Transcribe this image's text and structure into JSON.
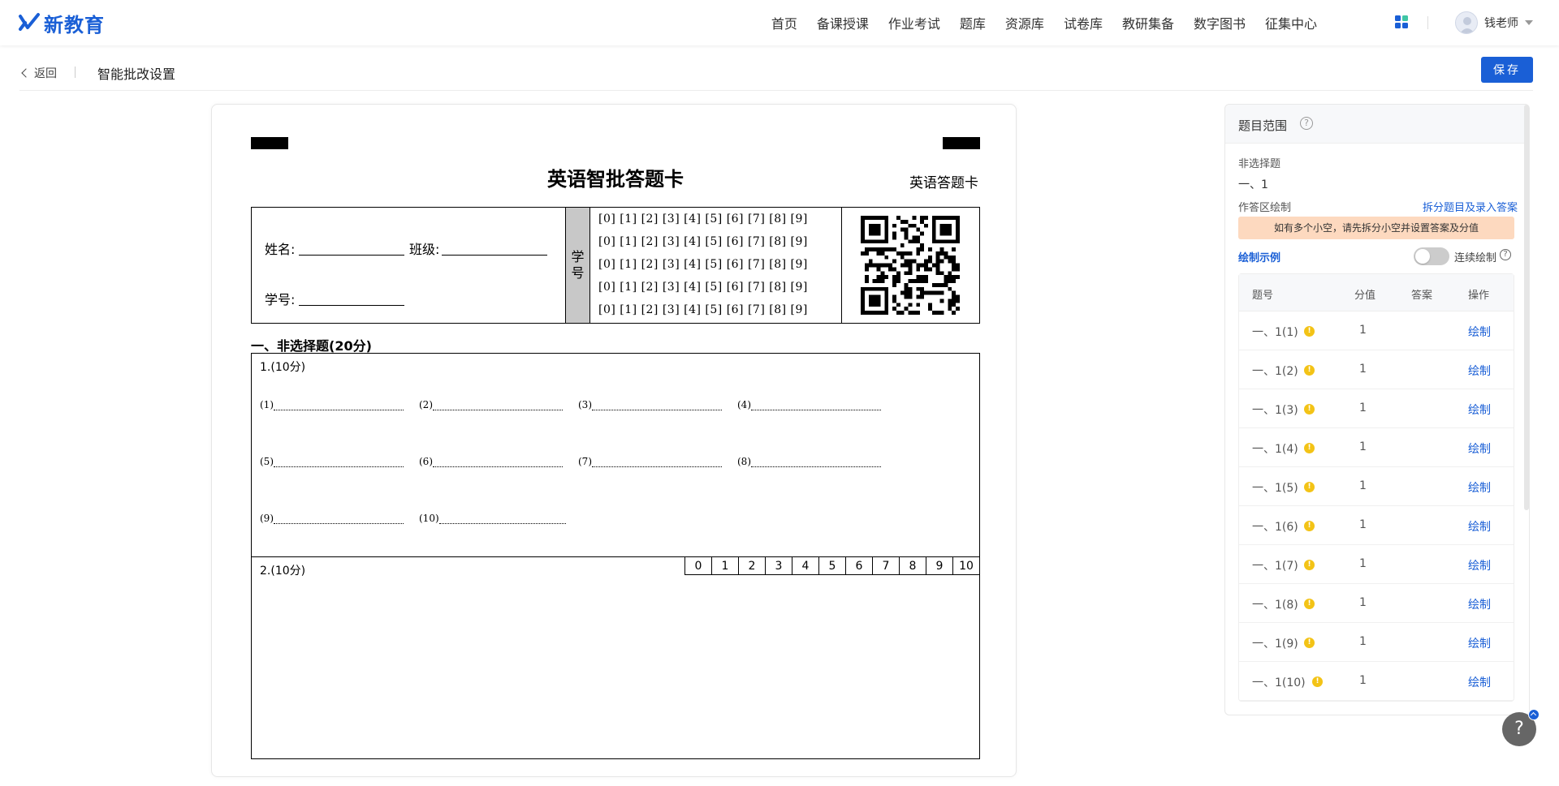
{
  "brand": {
    "name": "新教育",
    "color": "#1a5fd6"
  },
  "nav": {
    "items": [
      "首页",
      "备课授课",
      "作业考试",
      "题库",
      "资源库",
      "试卷库",
      "教研集备",
      "数字图书",
      "征集中心"
    ],
    "user_name": "钱老师"
  },
  "subheader": {
    "back_label": "返回",
    "title": "智能批改设置",
    "save_label": "保存"
  },
  "sheet": {
    "title": "英语智批答题卡",
    "subtitle": "英语答题卡",
    "name_label": "姓名:",
    "class_label": "班级:",
    "id_label": "学号:",
    "xuehao_label": [
      "学",
      "号"
    ],
    "digit_row": "[0] [1] [2] [3] [4] [5] [6] [7] [8] [9]",
    "digit_rows_count": 5,
    "section_title": "一、非选择题(20分)",
    "q1_head": "1.(10分)",
    "q1_blanks": [
      "(1)",
      "(2)",
      "(3)",
      "(4)",
      "(5)",
      "(6)",
      "(7)",
      "(8)",
      "(9)",
      "(10)"
    ],
    "q2_head": "2.(10分)",
    "q2_scores": [
      "0",
      "1",
      "2",
      "3",
      "4",
      "5",
      "6",
      "7",
      "8",
      "9",
      "10"
    ]
  },
  "panel": {
    "title": "题目范围",
    "nonchoice_label": "非选择题",
    "nonchoice_value": "一、1",
    "area_label": "作答区绘制",
    "split_link": "拆分题目及录入答案",
    "warning": "如有多个小空，请先拆分小空并设置答案及分值",
    "demo_link": "绘制示例",
    "toggle_label": "连续绘制",
    "toggle_on": false,
    "columns": [
      "题号",
      "分值",
      "答案",
      "操作"
    ],
    "rows": [
      {
        "num": "一、1(1)",
        "score": "1",
        "answer": "",
        "action": "绘制"
      },
      {
        "num": "一、1(2)",
        "score": "1",
        "answer": "",
        "action": "绘制"
      },
      {
        "num": "一、1(3)",
        "score": "1",
        "answer": "",
        "action": "绘制"
      },
      {
        "num": "一、1(4)",
        "score": "1",
        "answer": "",
        "action": "绘制"
      },
      {
        "num": "一、1(5)",
        "score": "1",
        "answer": "",
        "action": "绘制"
      },
      {
        "num": "一、1(6)",
        "score": "1",
        "answer": "",
        "action": "绘制"
      },
      {
        "num": "一、1(7)",
        "score": "1",
        "answer": "",
        "action": "绘制"
      },
      {
        "num": "一、1(8)",
        "score": "1",
        "answer": "",
        "action": "绘制"
      },
      {
        "num": "一、1(9)",
        "score": "1",
        "answer": "",
        "action": "绘制"
      },
      {
        "num": "一、1(10)",
        "score": "1",
        "answer": "",
        "action": "绘制"
      }
    ]
  },
  "help_fab_label": "?"
}
